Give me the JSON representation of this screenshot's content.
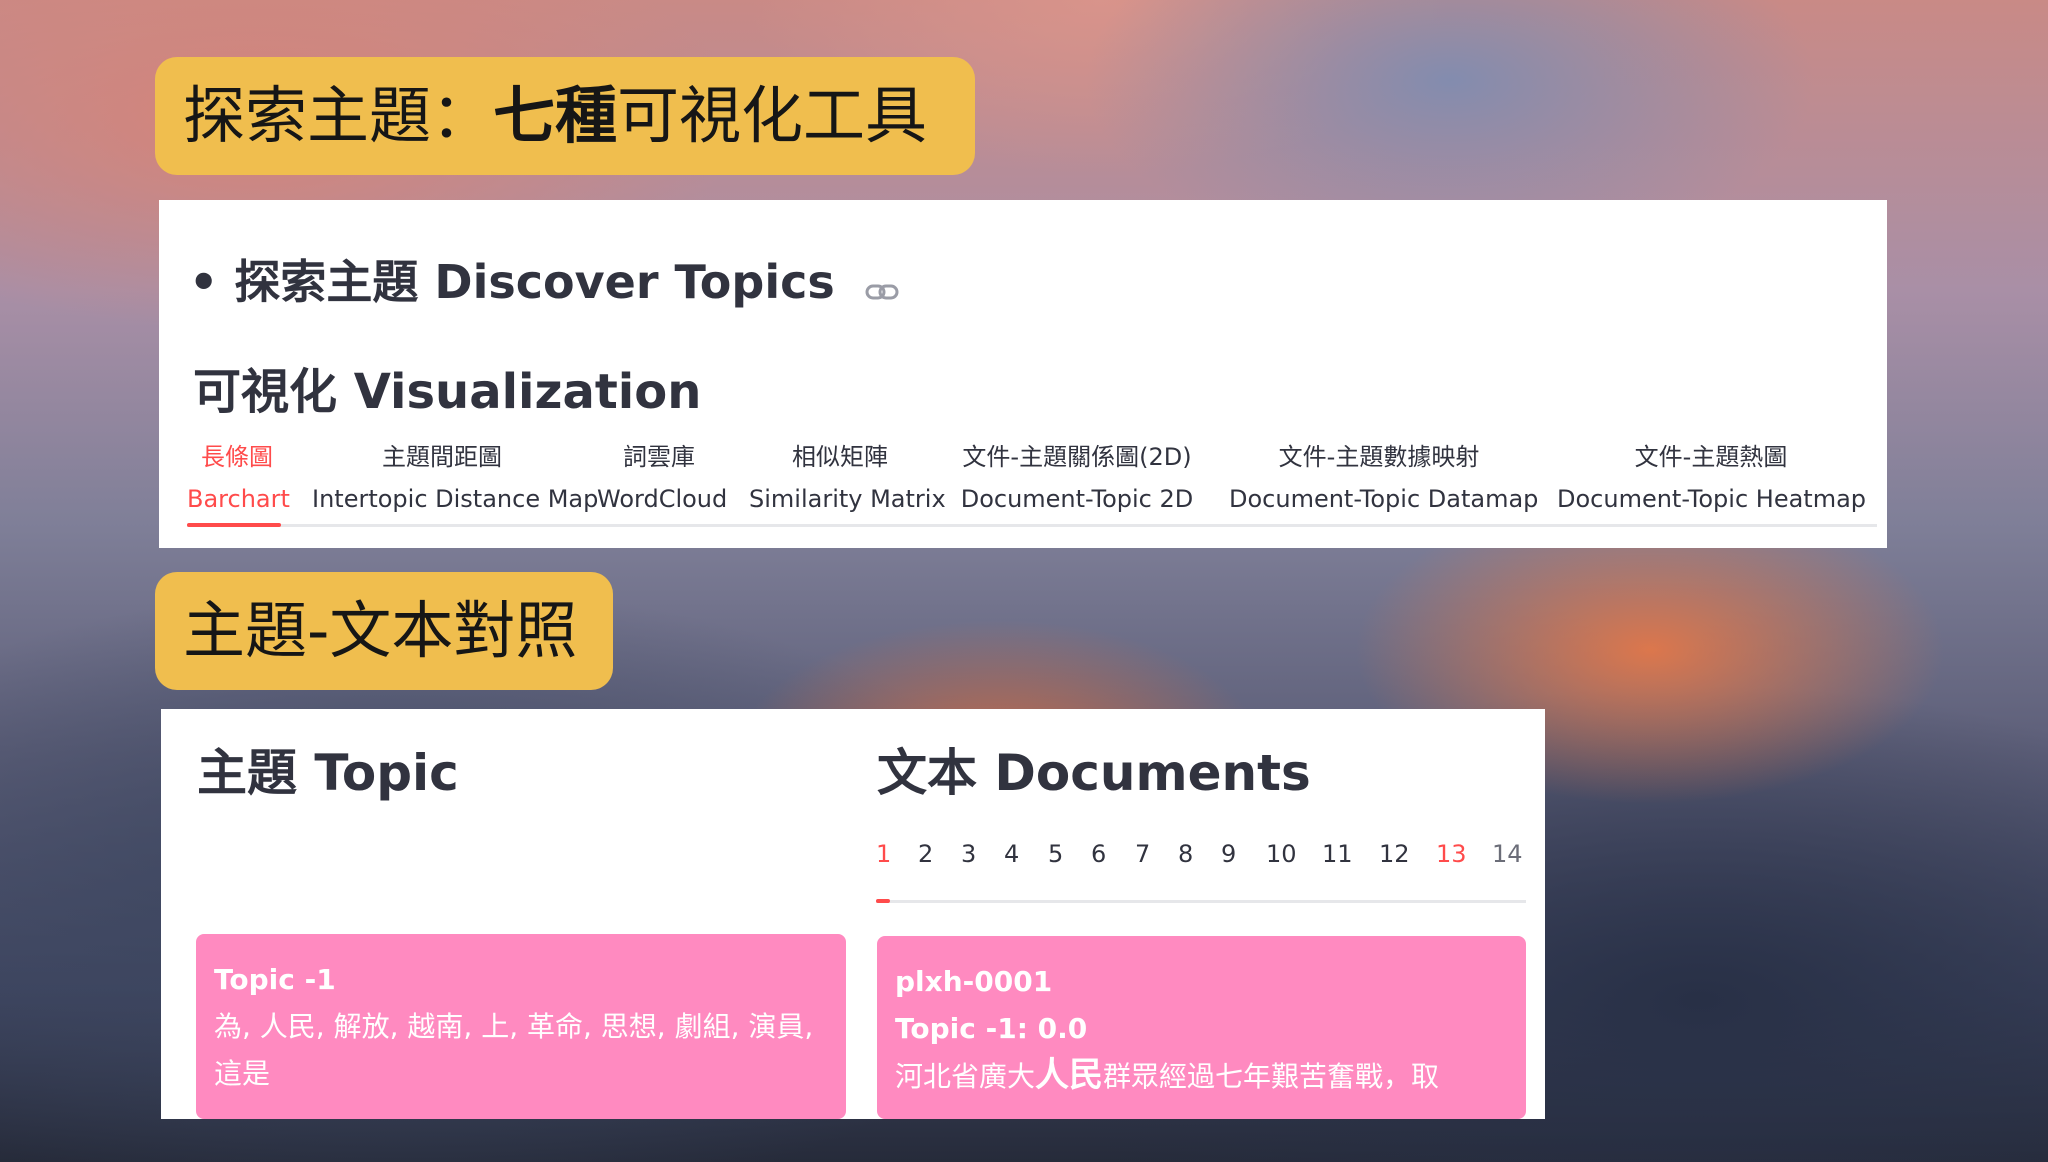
{
  "banner1": {
    "part1": "探索主題：",
    "part2": "七種",
    "part3": "可視化工具"
  },
  "panel1": {
    "bullet": "•",
    "discover_title": "探索主題 Discover Topics",
    "visualization_title": "可視化 Visualization",
    "tabs": [
      {
        "zh": "長條圖",
        "en": "Barchart"
      },
      {
        "zh": "主題間距圖",
        "en": "Intertopic Distance Map"
      },
      {
        "zh": "詞雲庫",
        "en": "WordCloud"
      },
      {
        "zh": "相似矩陣",
        "en": "Similarity Matrix"
      },
      {
        "zh": "文件-主題關係圖(2D)",
        "en": "Document-Topic 2D"
      },
      {
        "zh": "文件-主題數據映射",
        "en": "Document-Topic Datamap"
      },
      {
        "zh": "文件-主題熱圖",
        "en": "Document-Topic Heatmap"
      }
    ],
    "active_tab": "Barchart"
  },
  "banner2": {
    "text": "主題-文本對照"
  },
  "panel2": {
    "topic_heading": "主題 Topic",
    "documents_heading": "文本 Documents",
    "pages": [
      "1",
      "2",
      "3",
      "4",
      "5",
      "6",
      "7",
      "8",
      "9",
      "10",
      "11",
      "12",
      "13",
      "14"
    ],
    "active_page": "1",
    "highlighted_page": "13",
    "topic_card": {
      "title": "Topic -1",
      "words_line1": "為, 人民, 解放, 越南, 上, 革命, 思想, 劇組, 演員,",
      "words_line2": "這是"
    },
    "doc_card": {
      "id": "plxh-0001",
      "score": "Topic -1: 0.0",
      "text_before": "河北省廣大",
      "text_highlight": "人民",
      "text_after": "群眾經過七年艱苦奮戰，取"
    }
  },
  "colors": {
    "accent": "#ff4b4b",
    "pill": "#f0be4e",
    "card": "#ff8ac0",
    "text": "#31333f"
  }
}
